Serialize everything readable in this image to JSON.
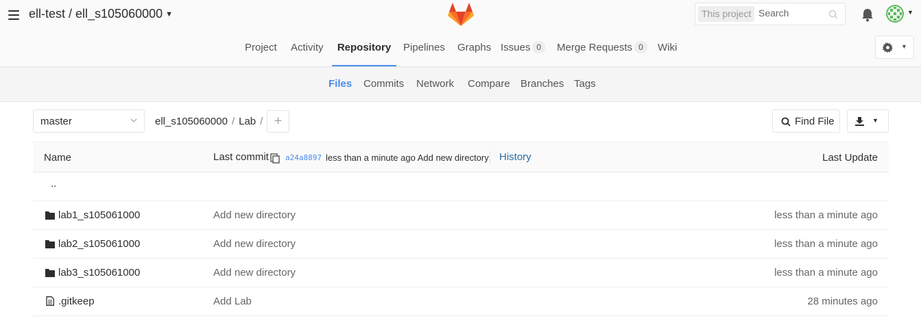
{
  "header": {
    "project_title": "ell-test / ell_s105060000",
    "search_scope": "This project",
    "search_placeholder": "Search"
  },
  "nav": {
    "items": [
      {
        "label": "Project"
      },
      {
        "label": "Activity"
      },
      {
        "label": "Repository"
      },
      {
        "label": "Pipelines"
      },
      {
        "label": "Graphs"
      },
      {
        "label": "Issues",
        "count": "0"
      },
      {
        "label": "Merge Requests",
        "count": "0"
      },
      {
        "label": "Wiki"
      }
    ],
    "active": "Repository"
  },
  "subnav": {
    "items": [
      "Files",
      "Commits",
      "Network",
      "Compare",
      "Branches",
      "Tags"
    ],
    "active": "Files"
  },
  "tree": {
    "branch": "master",
    "breadcrumb": [
      "ell_s105060000",
      "Lab"
    ],
    "find_file_label": "Find File"
  },
  "table": {
    "headers": {
      "name": "Name",
      "last_commit": "Last commit",
      "last_update": "Last Update"
    },
    "last_commit": {
      "sha": "a24a8897",
      "message": "less than a minute ago Add new directory",
      "history_label": "History"
    },
    "parent_dir": "..",
    "rows": [
      {
        "type": "folder",
        "name": "lab1_s105061000",
        "commit": "Add new directory",
        "updated": "less than a minute ago"
      },
      {
        "type": "folder",
        "name": "lab2_s105061000",
        "commit": "Add new directory",
        "updated": "less than a minute ago"
      },
      {
        "type": "folder",
        "name": "lab3_s105061000",
        "commit": "Add new directory",
        "updated": "less than a minute ago"
      },
      {
        "type": "file",
        "name": ".gitkeep",
        "commit": "Add Lab",
        "updated": "28 minutes ago"
      }
    ]
  },
  "colors": {
    "accent": "#4a8bee",
    "logo_orange": "#fc6d26",
    "logo_red": "#e24329",
    "logo_light": "#fca326"
  }
}
